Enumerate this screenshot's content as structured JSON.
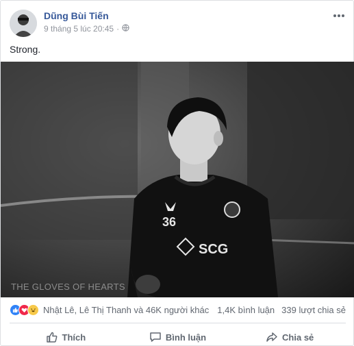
{
  "post": {
    "author": "Dũng Bùi Tiến",
    "timestamp": "9 tháng 5 lúc 20:45",
    "separator": "·",
    "privacy_icon": "globe-icon",
    "more_icon": "more-dots-icon",
    "text": "Strong.",
    "photo_watermark": "THE GLOVES OF HEARTS",
    "photo_jersey_sponsor": "SCG",
    "photo_jersey_number": "36"
  },
  "stats": {
    "reactions": [
      "like",
      "love",
      "haha"
    ],
    "reacted_by": "Nhật Lê, Lê Thị Thanh và 46K người khác",
    "comments": "1,4K bình luận",
    "shares": "339 lượt chia sẻ"
  },
  "actions": {
    "like_label": "Thích",
    "comment_label": "Bình luận",
    "share_label": "Chia sẻ"
  },
  "colors": {
    "author": "#365899",
    "meta": "#90949c",
    "like": "#2f82f7",
    "love": "#f0284a",
    "haha": "#f7c94a",
    "action": "#606770"
  }
}
